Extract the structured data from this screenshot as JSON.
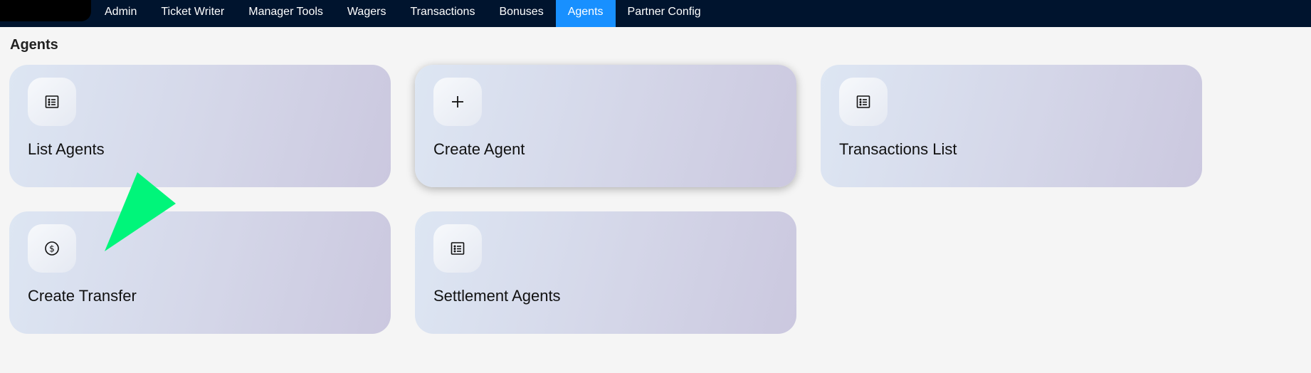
{
  "nav": {
    "items": [
      {
        "label": "Admin"
      },
      {
        "label": "Ticket Writer"
      },
      {
        "label": "Manager Tools"
      },
      {
        "label": "Wagers"
      },
      {
        "label": "Transactions"
      },
      {
        "label": "Bonuses"
      },
      {
        "label": "Agents",
        "active": true
      },
      {
        "label": "Partner Config"
      }
    ]
  },
  "page": {
    "title": "Agents"
  },
  "cards": [
    {
      "label": "List Agents",
      "icon": "list-icon"
    },
    {
      "label": "Create Agent",
      "icon": "plus-icon"
    },
    {
      "label": "Transactions List",
      "icon": "list-icon"
    },
    {
      "label": "Create Transfer",
      "icon": "dollar-circle-icon"
    },
    {
      "label": "Settlement Agents",
      "icon": "list-icon"
    }
  ],
  "colors": {
    "topbar": "#00142e",
    "active_tab": "#1890ff",
    "background": "#f5f5f5",
    "cursor": "#00f57a"
  }
}
